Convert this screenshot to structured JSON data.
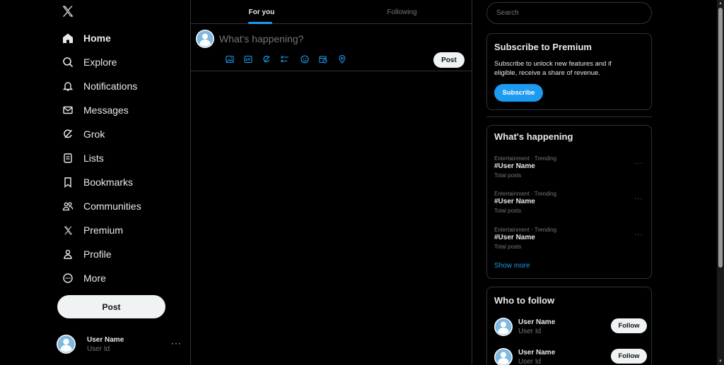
{
  "app": {
    "logo": "X"
  },
  "nav": {
    "items": [
      {
        "label": "Home",
        "icon": "home-icon"
      },
      {
        "label": "Explore",
        "icon": "search-icon"
      },
      {
        "label": "Notifications",
        "icon": "bell-icon"
      },
      {
        "label": "Messages",
        "icon": "mail-icon"
      },
      {
        "label": "Grok",
        "icon": "grok-icon"
      },
      {
        "label": "Lists",
        "icon": "list-icon"
      },
      {
        "label": "Bookmarks",
        "icon": "bookmark-icon"
      },
      {
        "label": "Communities",
        "icon": "communities-icon"
      },
      {
        "label": "Premium",
        "icon": "x-logo-icon"
      },
      {
        "label": "Profile",
        "icon": "person-icon"
      },
      {
        "label": "More",
        "icon": "more-circle-icon"
      }
    ],
    "post_label": "Post"
  },
  "account": {
    "name": "User Name",
    "id": "User Id",
    "more": "···"
  },
  "tabs": {
    "for_you": "For you",
    "following": "Following"
  },
  "composer": {
    "placeholder": "What's happening?",
    "post_label": "Post",
    "tools": [
      "image-icon",
      "gif-icon",
      "grok-icon",
      "poll-icon",
      "emoji-icon",
      "schedule-icon",
      "location-icon"
    ]
  },
  "search": {
    "placeholder": "Search"
  },
  "premium": {
    "title": "Subscribe to Premium",
    "description": "Subscribe to unlock new features and if eligible, receive a share of revenue.",
    "button": "Subscribe"
  },
  "trends": {
    "title": "What's happening",
    "items": [
      {
        "meta": "Entertainment · Trending",
        "name": "#User Name",
        "count": "Total posts"
      },
      {
        "meta": "Entertainment · Trending",
        "name": "#User Name",
        "count": "Total posts"
      },
      {
        "meta": "Entertainment · Trending",
        "name": "#User Name",
        "count": "Total posts"
      }
    ],
    "more": "···",
    "show_more": "Show more"
  },
  "who_to_follow": {
    "title": "Who to follow",
    "items": [
      {
        "name": "User Name",
        "id": "User Id",
        "button": "Follow"
      },
      {
        "name": "User Name",
        "id": "User Id",
        "button": "Follow"
      }
    ]
  },
  "colors": {
    "accent": "#1d9bf0",
    "background": "#000000",
    "border": "#2f3336",
    "muted": "#71767b",
    "text": "#e7e9ea"
  }
}
